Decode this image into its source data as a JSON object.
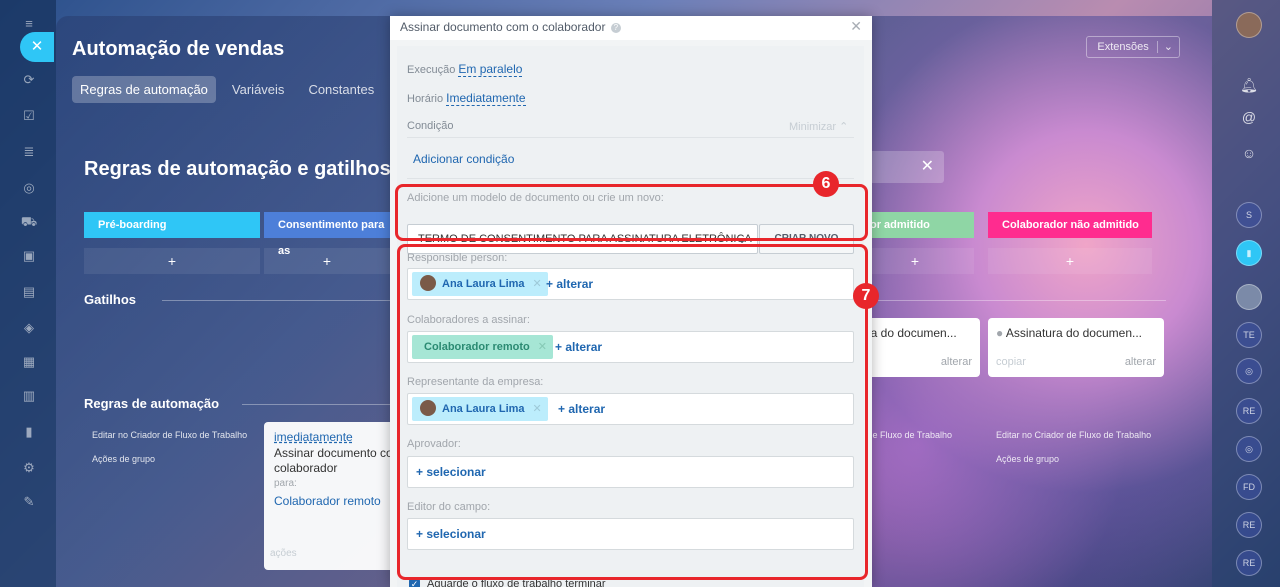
{
  "slider": {
    "title": "Automação de vendas",
    "tabs": [
      "Regras de automação",
      "Variáveis",
      "Constantes"
    ],
    "extensions": "Extensões",
    "section_title": "Regras de automação e gatilhos",
    "stages": [
      {
        "label": "Pré-boarding",
        "color": "#2fc6f6"
      },
      {
        "label": "Consentimento para as",
        "color": "#4d7fd9"
      },
      {
        "label": "or admitido",
        "color": "#8fd6a5"
      },
      {
        "label": "Colaborador não admitido",
        "color": "#ff2c8f"
      }
    ],
    "triggers_label": "Gatilhos",
    "rules_label": "Regras de automação",
    "edit_flow": "Editar no Criador de Fluxo de Trabalho",
    "group_actions": "Ações de grupo",
    "edit_flow_right1": "r de Fluxo de Trabalho",
    "edit_flow_right2": "Editar no Criador de Fluxo de Trabalho",
    "group_actions_right": "Ações de grupo",
    "rule_card": {
      "timing": "imediatamente",
      "action": "Assinar documento co colaborador",
      "for_label": "para:",
      "target": "Colaborador remoto",
      "actions": "ações"
    },
    "trigger_cards": [
      {
        "title": "ura do documen...",
        "link": "alterar"
      },
      {
        "title": "Assinatura do documen...",
        "copy": "copiar",
        "link": "alterar"
      }
    ]
  },
  "modal": {
    "title": "Assinar documento com o colaborador",
    "execution_label": "Execução",
    "execution_value": "Em paralelo",
    "time_label": "Horário",
    "time_value": "Imediatamente",
    "condition_label": "Condição",
    "minimize": "Minimizar",
    "add_condition": "Adicionar condição",
    "template_label": "Adicione um modelo de documento ou crie um novo:",
    "template_value": "TERMO DE CONSENTIMENTO PARA ASSINATURA ELETRÔNICA",
    "create_new": "CRIAR NOVO",
    "responsible_label": "Responsible person:",
    "responsible_tag": "Ana Laura Lima",
    "change": "+ alterar",
    "signers_label": "Colaboradores a assinar:",
    "signers_tag": "Colaborador remoto",
    "company_rep_label": "Representante da empresa:",
    "company_rep_tag": "Ana Laura Lima",
    "approver_label": "Aprovador:",
    "select": "+ selecionar",
    "field_editor_label": "Editor do campo:",
    "wait_checkbox": "Aguarde o fluxo de trabalho terminar"
  },
  "badges": {
    "six": "6",
    "seven": "7"
  },
  "right_sidebar": [
    "S",
    "TE",
    "RE",
    "FD",
    "RE",
    "RE"
  ]
}
